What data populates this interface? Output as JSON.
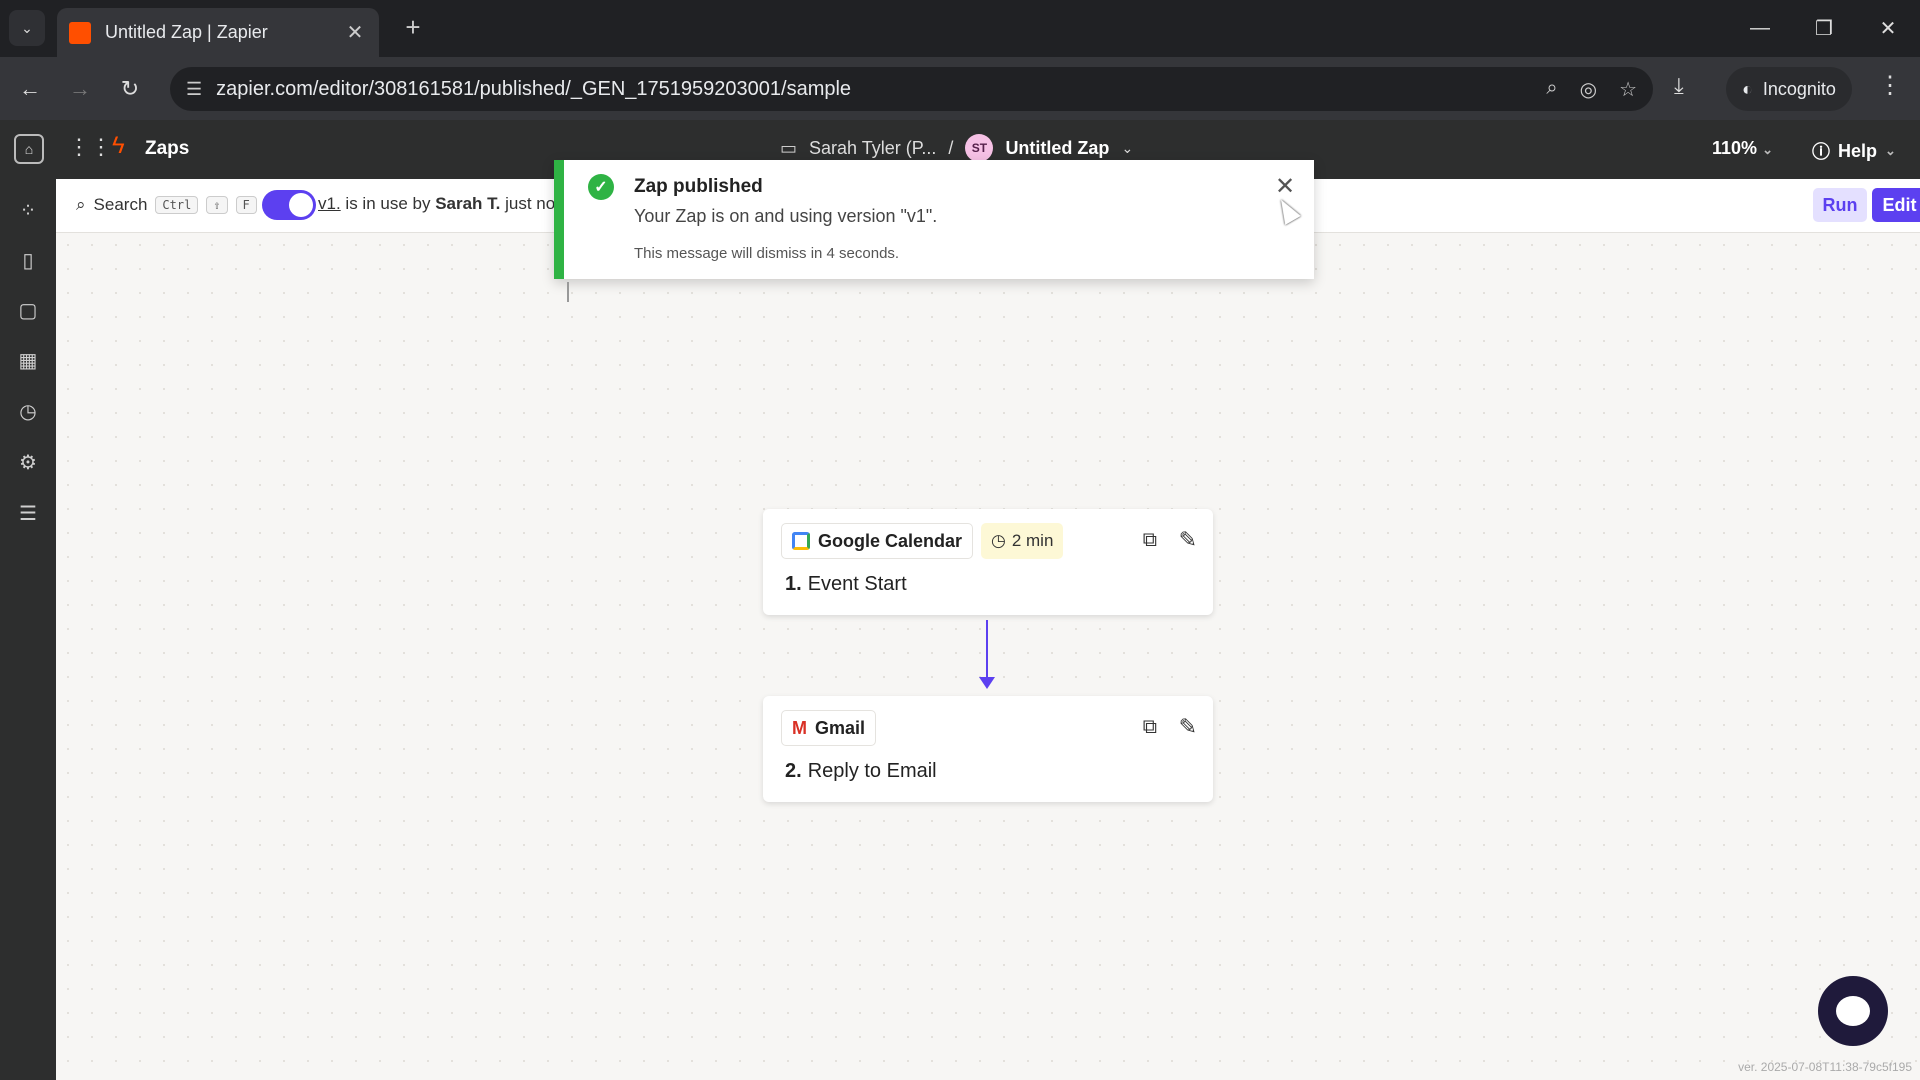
{
  "browser": {
    "tab_title": "Untitled Zap | Zapier",
    "url": "zapier.com/editor/308161581/published/_GEN_1751959203001/sample",
    "incognito_label": "Incognito"
  },
  "header": {
    "app_name": "Zaps",
    "breadcrumb_owner": "Sarah Tyler (P...",
    "breadcrumb_sep": "/",
    "avatar_initials": "ST",
    "zap_name": "Untitled Zap",
    "zoom": "110%",
    "help_label": "Help"
  },
  "toolbar": {
    "search_label": "Search",
    "kbd_ctrl": "Ctrl",
    "kbd_shift": "⇧",
    "kbd_f": "F",
    "version_link": "v1.",
    "status_middle": " is in use by ",
    "status_user": "Sarah T.",
    "status_time": " just now",
    "run_label": "Run",
    "edit_label": "Edit Zap"
  },
  "toast": {
    "title": "Zap published",
    "body": "Your Zap is on and using version \"v1\".",
    "note": "This message will dismiss in 4 seconds."
  },
  "steps": [
    {
      "app": "Google Calendar",
      "time": "2 min",
      "number": "1.",
      "label": "Event Start"
    },
    {
      "app": "Gmail",
      "number": "2.",
      "label": "Reply to Email"
    }
  ],
  "footer": {
    "version": "ver. 2025-07-08T11:38-79c5f195"
  },
  "colors": {
    "accent": "#5c40f0",
    "success": "#2fb344",
    "brand": "#ff4f00"
  }
}
